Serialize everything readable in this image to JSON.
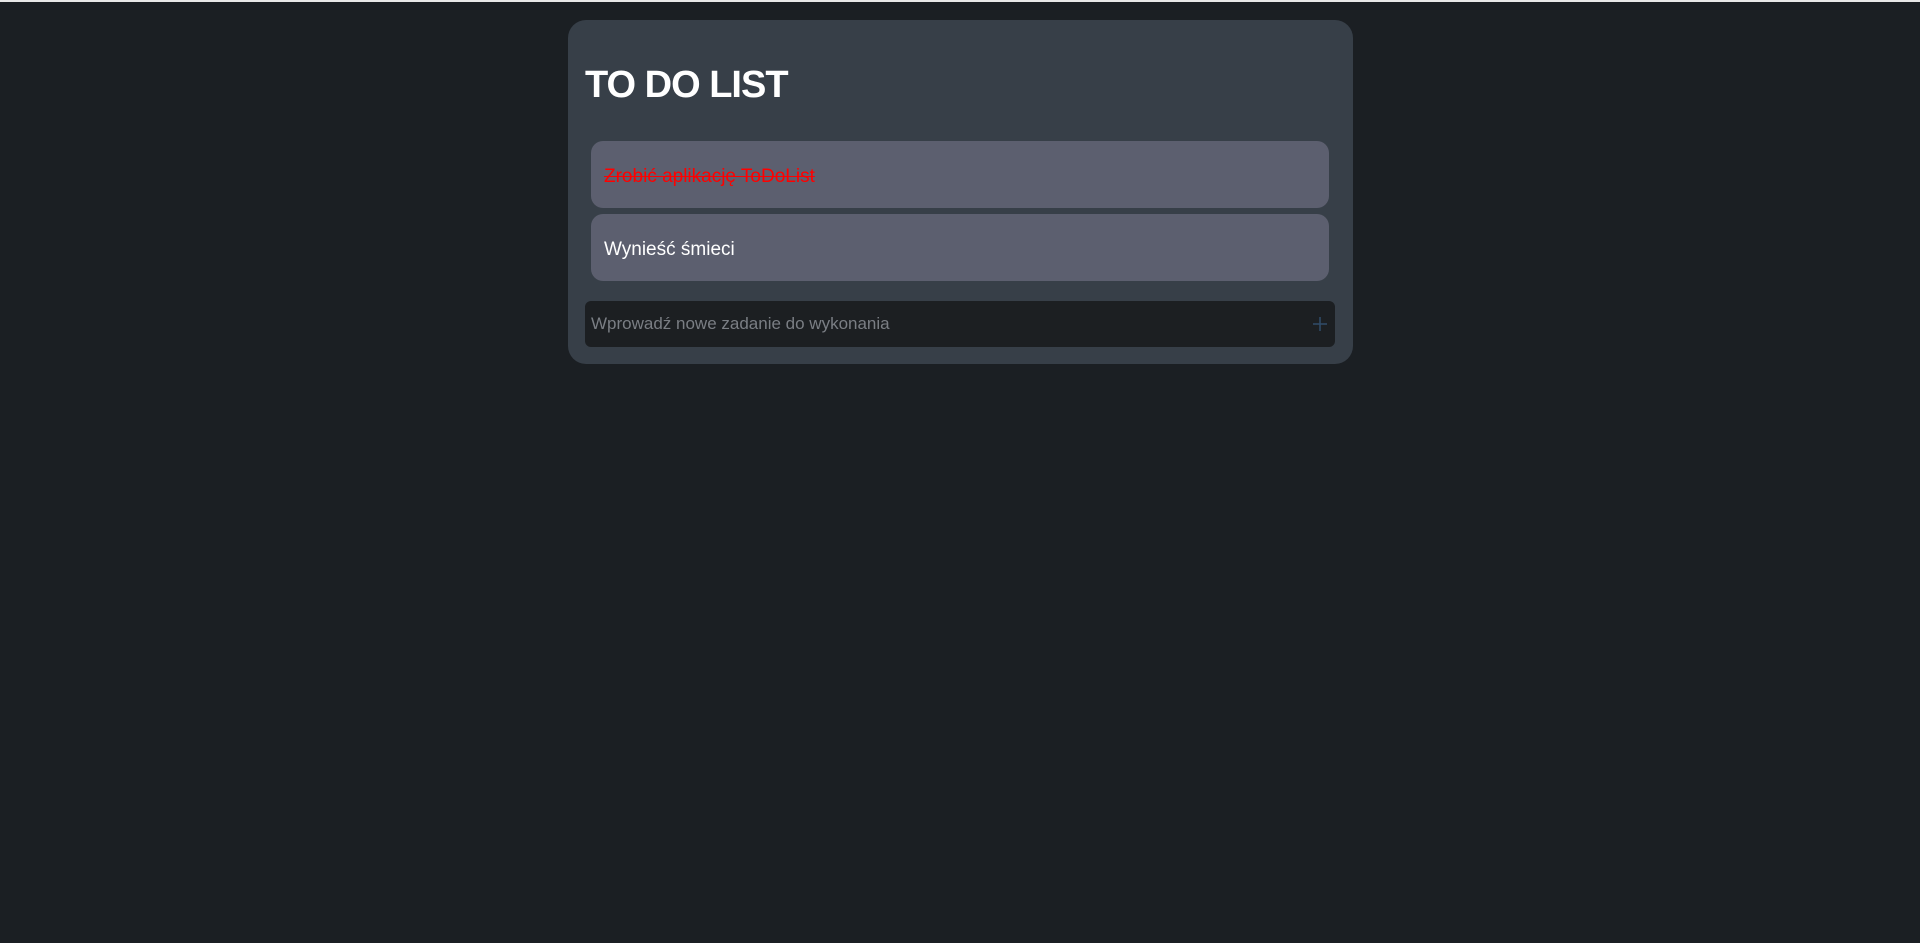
{
  "app": {
    "title": "TO DO LIST"
  },
  "tasks": [
    {
      "label": "Zrobić aplikację ToDoList",
      "completed": true
    },
    {
      "label": "Wynieść śmieci",
      "completed": false
    }
  ],
  "new_task": {
    "placeholder": "Wprowadź nowe zadanie do wykonania",
    "value": "",
    "add_icon": "plus-icon"
  },
  "colors": {
    "page_background": "#1b1f23",
    "card_background": "#373f48",
    "task_background": "#5c5f6f",
    "completed_text": "#ff0000",
    "input_background": "#1c1f22",
    "add_icon": "#2f4a66"
  }
}
